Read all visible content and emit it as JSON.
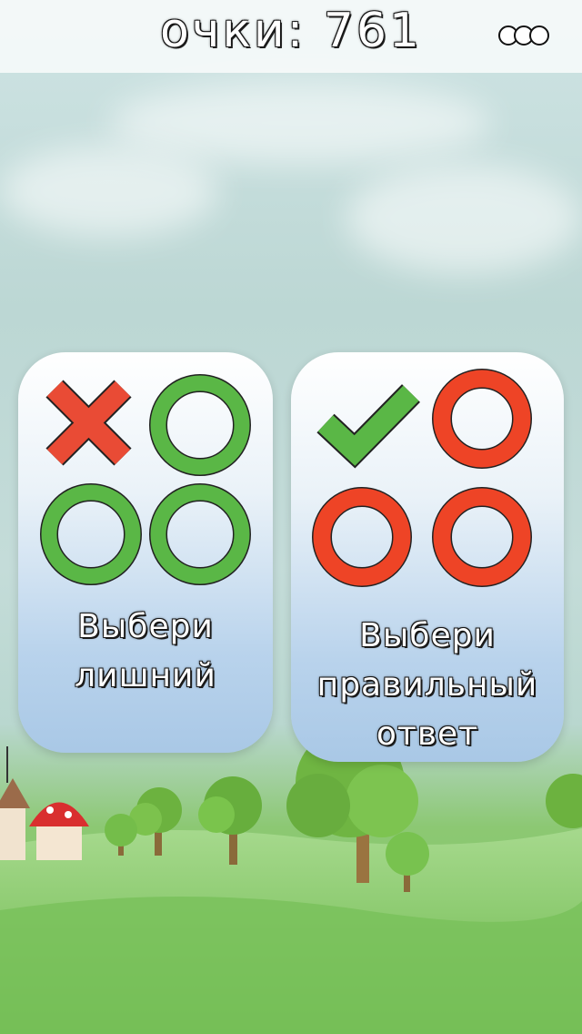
{
  "header": {
    "score_text": "очки: 761",
    "menu_icon": "three-circles-menu-icon"
  },
  "cards": [
    {
      "id": "odd-one-out",
      "label_lines": [
        "Выбери",
        "лишний"
      ],
      "icons": [
        "cross-icon",
        "circle-icon",
        "circle-icon",
        "circle-icon"
      ],
      "icon_colors": [
        "#e94b35",
        "#5ab746",
        "#5ab746",
        "#5ab746"
      ]
    },
    {
      "id": "correct-answer",
      "label_lines": [
        "Выбери",
        "правильный",
        "ответ"
      ],
      "icons": [
        "checkmark-icon",
        "circle-icon",
        "circle-icon",
        "circle-icon"
      ],
      "icon_colors": [
        "#5ab746",
        "#ee4426",
        "#ee4426",
        "#ee4426"
      ]
    }
  ],
  "colors": {
    "green": "#5ab746",
    "red": "#ee4426"
  }
}
